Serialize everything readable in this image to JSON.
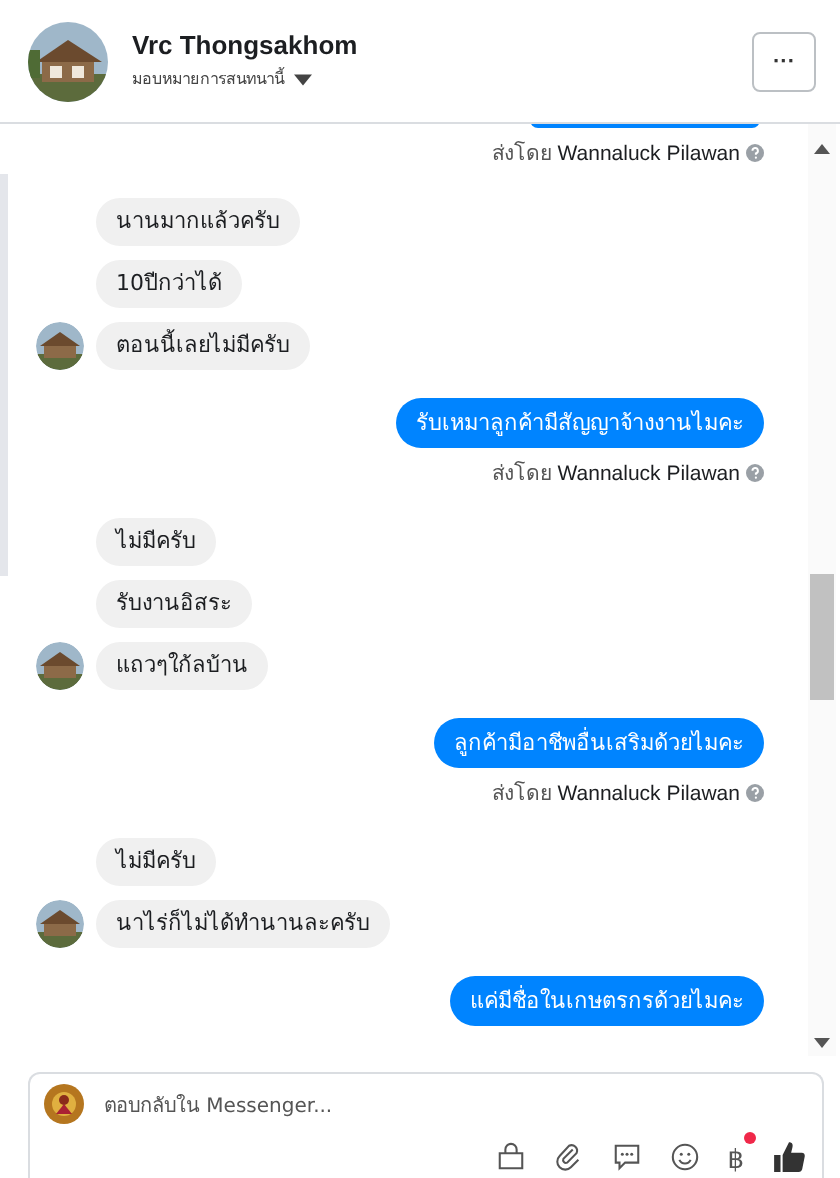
{
  "header": {
    "name": "Vrc Thongsakhom",
    "assign_label": "มอบหมายการสนทนานี้",
    "more_button": "···"
  },
  "messages": [
    {
      "kind": "outgoing_clipped",
      "sent_prefix": "ส่งโดย",
      "sent_name": "Wannaluck Pilawan"
    },
    {
      "kind": "incoming",
      "texts": [
        "นานมากแล้วครับ",
        "10ปีกว่าได้",
        "ตอนนี้เลยไม่มีครับ"
      ]
    },
    {
      "kind": "outgoing",
      "text": "รับเหมาลูกค้ามีสัญญาจ้างงานไมคะ",
      "sent_prefix": "ส่งโดย",
      "sent_name": "Wannaluck Pilawan"
    },
    {
      "kind": "incoming",
      "texts": [
        "ไม่มีครับ",
        "รับงานอิสระ",
        "แถวๆใก้ลบ้าน"
      ]
    },
    {
      "kind": "outgoing",
      "text": "ลูกค้ามีอาชีพอื่นเสริมด้วยไมคะ",
      "sent_prefix": "ส่งโดย",
      "sent_name": "Wannaluck Pilawan"
    },
    {
      "kind": "incoming",
      "texts": [
        "ไม่มีครับ",
        "นาไร่ก็ไม่ได้ทำนานละครับ"
      ]
    },
    {
      "kind": "outgoing",
      "text": "แค่มีชื่อในเกษตรกรด้วยไมคะ"
    }
  ],
  "composer": {
    "placeholder": "ตอบกลับใน Messenger...",
    "currency_symbol": "฿",
    "currency_badge": true
  }
}
